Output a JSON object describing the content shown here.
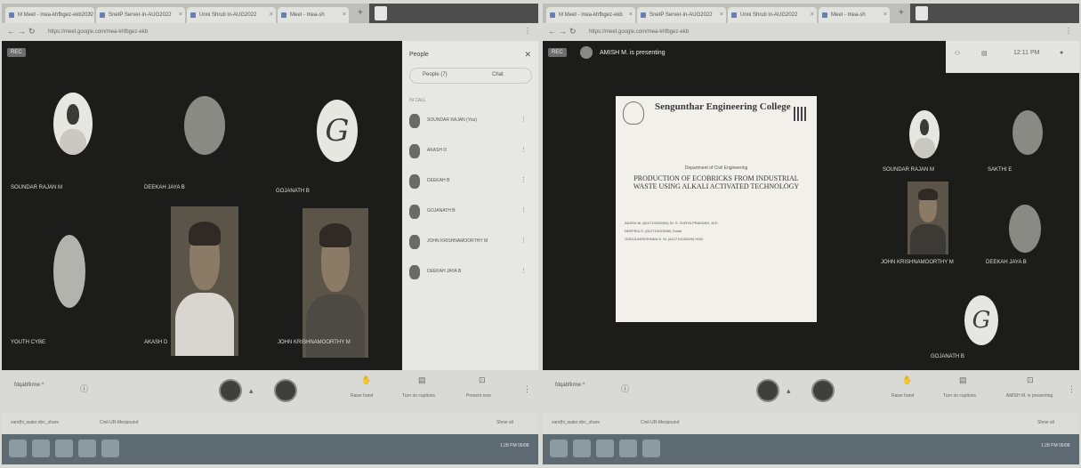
{
  "left": {
    "tabs": [
      "M Meet - mea-khfbgez-ekb2022",
      "SnetP Server-in-AUG2022",
      "Unni Shruti in-AUG2022",
      "Meet - mea-sh"
    ],
    "url": "https://meet.google.com/mea-khfbgez-ekb",
    "rec": "REC",
    "tiles": [
      "SOUNDAR RAJAN M",
      "DEEKAH JAYA B",
      "GOJANATH B",
      "YOUTH CYBE",
      "AKASH D",
      "JOHN KRISHNAMOORTHY M"
    ],
    "people_title": "People",
    "people_tab": "People (7)",
    "chat_tab": "Chat",
    "in_meeting": "IN CALL",
    "participants": [
      "SOUNDAR RAJAN (You)",
      "AKASH D",
      "DEEKAH B",
      "GOJANATH B",
      "JOHN KRISHNAMOORTHY M",
      "DEEKAH JAYA B"
    ],
    "meet_id": "fdqabfkmw ^",
    "controls": {
      "raise_hand": "Raise hand",
      "captions": "Turn on captions",
      "present": "Present now"
    },
    "downloads": [
      "sandhi_water.doc_share",
      "Civil-UR-Mexpound"
    ],
    "show_all": "Show all",
    "time": "1:28 PM 05/08"
  },
  "right": {
    "tabs": [
      "M Meet - mea-khfbgez-ekb",
      "SnetP Server-in-AUG2022",
      "Unni Shruti in-AUG2022",
      "Meet - mea-sh"
    ],
    "url": "https://meet.google.com/mea-khfbgez-ekb",
    "rec": "REC",
    "presenting": "AMISH M. is presenting",
    "top_time": "12:11 PM",
    "slide": {
      "college": "Sengunthar Engineering College",
      "department": "Department of Civil Engineering",
      "title": "PRODUCTION OF ECOBRICKS FROM INDUSTRIAL WASTE USING ALKALI ACTIVATED TECHNOLOGY",
      "rows": [
        "AKASH M.        (612719103004)        Dr. S. SURYA PRAKASH, M.E.",
        "DEEPIKA S.       (612719103006)        Guide",
        "GOKULAKRISHNAN K. M. (612719103009)   HOD"
      ]
    },
    "tiles": [
      "SOUNDAR RAJAN M",
      "SAKTHI E",
      "JOHN KRISHNAMOORTHY M",
      "DEEKAH JAYA B",
      "GOJANATH B"
    ],
    "meet_id": "fdqabfkmw ^",
    "controls": {
      "raise_hand": "Raise hand",
      "captions": "Turn on captions",
      "present": "AMISH M. is presenting"
    },
    "downloads": [
      "sandhi_water.doc_share",
      "Civil-UR-Mexpound"
    ],
    "show_all": "Show all",
    "time": "1:28 PM 05/08"
  }
}
